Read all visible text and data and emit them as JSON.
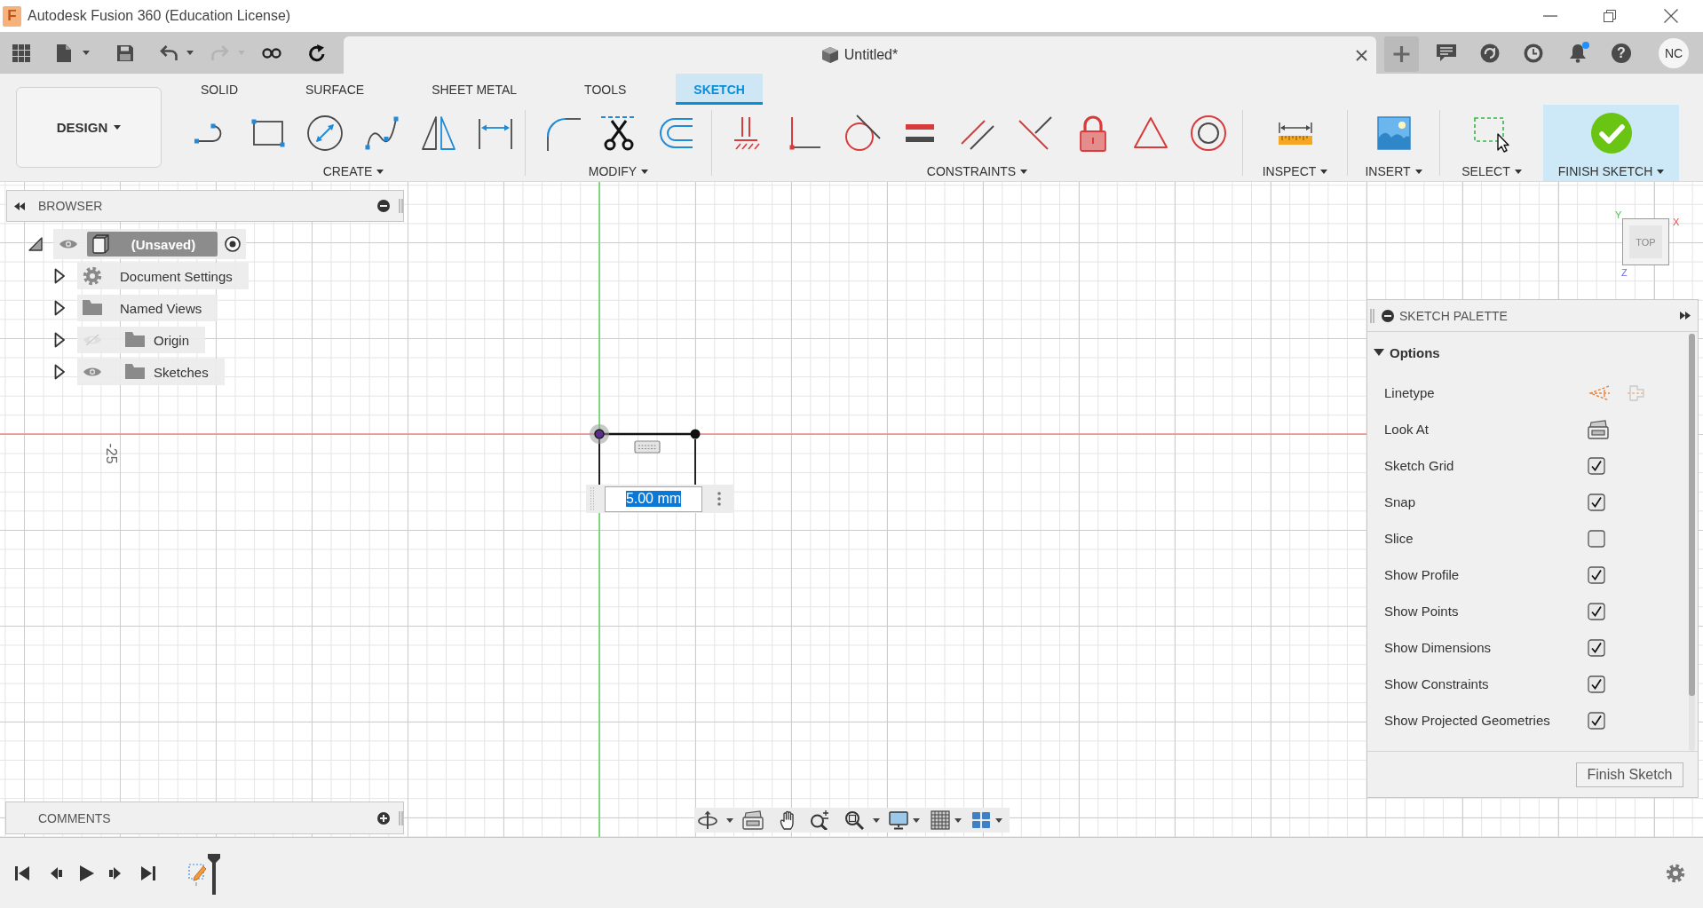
{
  "window": {
    "logo_letter": "F",
    "title": "Autodesk Fusion 360 (Education License)"
  },
  "quick_access": {
    "undo": {
      "disabled": false
    },
    "redo": {
      "disabled": true
    }
  },
  "document_tab": {
    "title": "Untitled*"
  },
  "header_icons": {
    "notifications": {
      "unread": true
    },
    "help": {
      "label": "?"
    },
    "user": {
      "initials": "NC"
    }
  },
  "workspace_button": {
    "label": "DESIGN"
  },
  "toolbar_tabs": [
    {
      "label": "SOLID",
      "selected": false
    },
    {
      "label": "SURFACE",
      "selected": false
    },
    {
      "label": "SHEET METAL",
      "selected": false
    },
    {
      "label": "TOOLS",
      "selected": false
    },
    {
      "label": "SKETCH",
      "selected": true
    }
  ],
  "tool_groups": [
    {
      "label": "CREATE",
      "kind": "tools"
    },
    {
      "label": "MODIFY",
      "kind": "tools"
    },
    {
      "label": "CONSTRAINTS",
      "kind": "tools"
    },
    {
      "label": "INSPECT",
      "kind": "tools"
    },
    {
      "label": "INSERT",
      "kind": "tools"
    },
    {
      "label": "SELECT",
      "kind": "tools"
    },
    {
      "label": "FINISH SKETCH",
      "kind": "commit"
    }
  ],
  "browser": {
    "title": "BROWSER",
    "tree": [
      {
        "label": "(Unsaved)",
        "kind": "component",
        "visible": true,
        "expanded": true,
        "children": [
          {
            "label": "Document Settings",
            "kind": "settings",
            "expanded": false
          },
          {
            "label": "Named Views",
            "kind": "folder",
            "expanded": false
          },
          {
            "label": "Origin",
            "kind": "folder",
            "visible": false,
            "expanded": false
          },
          {
            "label": "Sketches",
            "kind": "folder",
            "visible": true,
            "expanded": false
          }
        ]
      }
    ]
  },
  "canvas": {
    "axis_label": "-25",
    "dimension_input": {
      "value": "5.00 mm",
      "text_selected": true
    }
  },
  "viewcube": {
    "face": "TOP",
    "x_label": "X",
    "y_label": "Y",
    "z_label": "Z"
  },
  "sketch_palette": {
    "title": "SKETCH PALETTE",
    "section": {
      "label": "Options",
      "expanded": true
    },
    "rows": [
      {
        "label": "Linetype",
        "kind": "linetype"
      },
      {
        "label": "Look At",
        "kind": "action"
      },
      {
        "label": "Sketch Grid",
        "kind": "checkbox",
        "checked": true
      },
      {
        "label": "Snap",
        "kind": "checkbox",
        "checked": true
      },
      {
        "label": "Slice",
        "kind": "checkbox",
        "checked": false
      },
      {
        "label": "Show Profile",
        "kind": "checkbox",
        "checked": true
      },
      {
        "label": "Show Points",
        "kind": "checkbox",
        "checked": true
      },
      {
        "label": "Show Dimensions",
        "kind": "checkbox",
        "checked": true
      },
      {
        "label": "Show Constraints",
        "kind": "checkbox",
        "checked": true
      },
      {
        "label": "Show Projected Geometries",
        "kind": "checkbox",
        "checked": true
      }
    ],
    "button": "Finish Sketch"
  },
  "comments": {
    "title": "COMMENTS"
  }
}
